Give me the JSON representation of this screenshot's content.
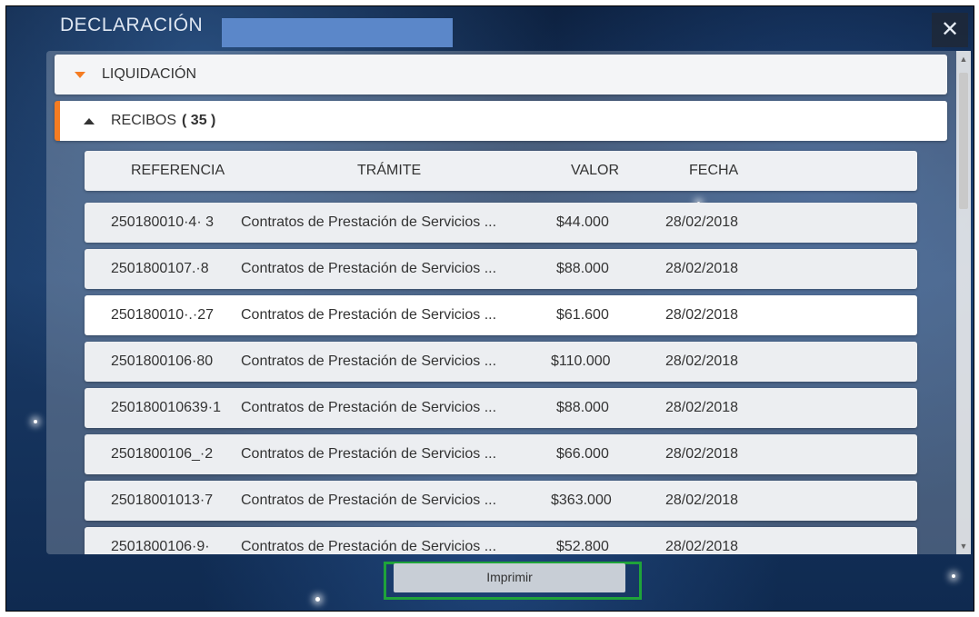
{
  "dialog": {
    "title": "DECLARACIÓN",
    "close_label": "✕"
  },
  "accordion": {
    "liquidacion_label": "LIQUIDACIÓN",
    "recibos_label": "RECIBOS",
    "recibos_count": "( 35 )"
  },
  "table": {
    "headers": {
      "referencia": "REFERENCIA",
      "tramite": "TRÁMITE",
      "valor": "VALOR",
      "fecha": "FECHA"
    },
    "rows": [
      {
        "referencia": "250180010·4· 3",
        "tramite": "Contratos de Prestación de Servicios ...",
        "valor": "$44.000",
        "fecha": "28/02/2018"
      },
      {
        "referencia": "2501800107.·8",
        "tramite": "Contratos de Prestación de Servicios ...",
        "valor": "$88.000",
        "fecha": "28/02/2018"
      },
      {
        "referencia": "250180010·.·27",
        "tramite": "Contratos de Prestación de Servicios ...",
        "valor": "$61.600",
        "fecha": "28/02/2018"
      },
      {
        "referencia": "2501800106·80",
        "tramite": "Contratos de Prestación de Servicios ...",
        "valor": "$110.000",
        "fecha": "28/02/2018"
      },
      {
        "referencia": "250180010639·1",
        "tramite": "Contratos de Prestación de Servicios ...",
        "valor": "$88.000",
        "fecha": "28/02/2018"
      },
      {
        "referencia": "2501800106_·2",
        "tramite": "Contratos de Prestación de Servicios ...",
        "valor": "$66.000",
        "fecha": "28/02/2018"
      },
      {
        "referencia": "25018001013·7",
        "tramite": "Contratos de Prestación de Servicios ...",
        "valor": "$363.000",
        "fecha": "28/02/2018"
      },
      {
        "referencia": "2501800106·9·",
        "tramite": "Contratos de Prestación de Servicios ...",
        "valor": "$52.800",
        "fecha": "28/02/2018"
      }
    ]
  },
  "footer": {
    "print_label": "Imprimir"
  },
  "colors": {
    "accent": "#f57c22",
    "highlight_box": "#1fa33a",
    "redaction": "#5b87c9"
  }
}
